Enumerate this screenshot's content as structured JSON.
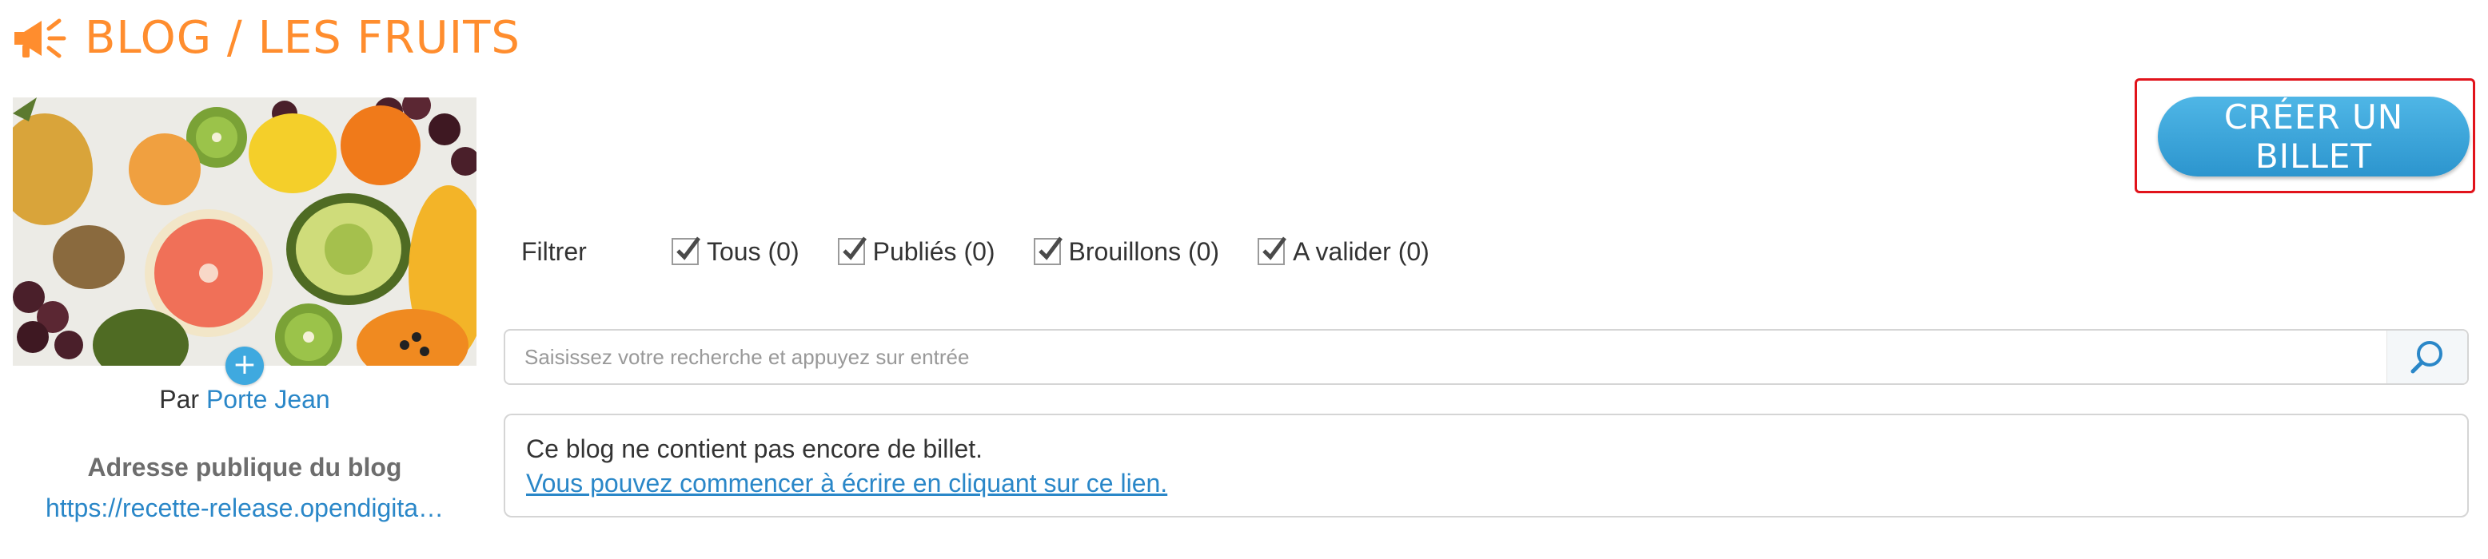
{
  "header": {
    "title": "BLOG / LES FRUITS",
    "icon": "megaphone-icon",
    "accent_color": "#ff8d2e"
  },
  "sidebar": {
    "add_image_symbol": "+",
    "author_prefix": "Par",
    "author_name": "Porte Jean",
    "public_address_label": "Adresse publique du blog",
    "public_address_url": "https://recette-release.opendigita…"
  },
  "toolbar": {
    "create_label": "CRÉER UN BILLET"
  },
  "filters": {
    "label": "Filtrer",
    "items": [
      {
        "label": "Tous (0)",
        "checked": true
      },
      {
        "label": "Publiés (0)",
        "checked": true
      },
      {
        "label": "Brouillons (0)",
        "checked": true
      },
      {
        "label": "A valider (0)",
        "checked": true
      }
    ]
  },
  "search": {
    "placeholder": "Saisissez votre recherche et appuyez sur entrée",
    "value": "",
    "icon": "search-icon"
  },
  "empty_state": {
    "message": "Ce blog ne contient pas encore de billet.",
    "link": "Vous pouvez commencer à écrire en cliquant sur ce lien."
  },
  "colors": {
    "link": "#2a87c8",
    "button": "#3fa9df",
    "highlight": "#e1131b"
  }
}
